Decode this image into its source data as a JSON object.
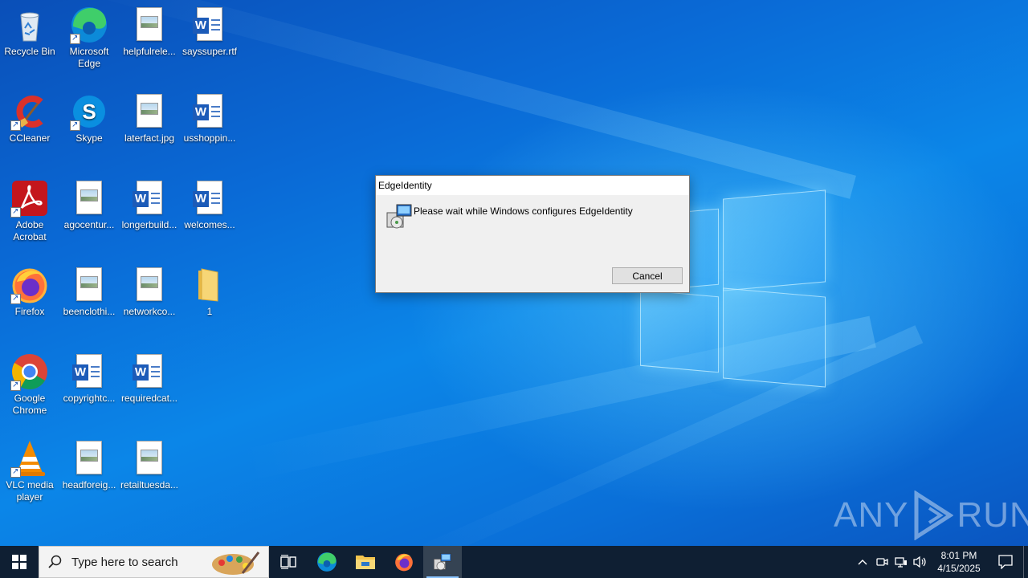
{
  "desktop": {
    "icons": [
      {
        "label": "Recycle Bin",
        "icon": "recycle-bin-icon"
      },
      {
        "label": "Microsoft Edge",
        "icon": "edge-icon"
      },
      {
        "label": "helpfulrele...",
        "icon": "image-file-icon"
      },
      {
        "label": "sayssuper.rtf",
        "icon": "word-doc-icon"
      },
      {
        "label": "CCleaner",
        "icon": "ccleaner-icon"
      },
      {
        "label": "Skype",
        "icon": "skype-icon"
      },
      {
        "label": "laterfact.jpg",
        "icon": "image-file-icon"
      },
      {
        "label": "usshoppin...",
        "icon": "word-doc-icon"
      },
      {
        "label": "Adobe Acrobat",
        "icon": "acrobat-icon"
      },
      {
        "label": "agocentur...",
        "icon": "image-file-icon"
      },
      {
        "label": "longerbuild...",
        "icon": "word-doc-icon"
      },
      {
        "label": "welcomes...",
        "icon": "word-doc-icon"
      },
      {
        "label": "Firefox",
        "icon": "firefox-icon"
      },
      {
        "label": "beenclothi...",
        "icon": "image-file-icon"
      },
      {
        "label": "networkco...",
        "icon": "image-file-icon"
      },
      {
        "label": "1",
        "icon": "folder-icon"
      },
      {
        "label": "Google Chrome",
        "icon": "chrome-icon"
      },
      {
        "label": "copyrightc...",
        "icon": "word-doc-icon"
      },
      {
        "label": "requiredcat...",
        "icon": "word-doc-icon"
      },
      {
        "label": "VLC media player",
        "icon": "vlc-icon"
      },
      {
        "label": "headforeig...",
        "icon": "image-file-icon"
      },
      {
        "label": "retailtuesda...",
        "icon": "image-file-icon"
      }
    ],
    "watermark": {
      "left": "ANY",
      "right": "RUN"
    }
  },
  "dialog": {
    "title": "EdgeIdentity",
    "message": "Please wait while Windows configures EdgeIdentity",
    "cancel_label": "Cancel",
    "icon": "installer-icon"
  },
  "taskbar": {
    "search_placeholder": "Type here to search",
    "apps": [
      "task-view-icon",
      "edge-icon",
      "file-explorer-icon",
      "firefox-icon",
      "installer-icon"
    ],
    "active_app": "installer-icon",
    "clock": {
      "time": "8:01 PM",
      "date": "4/15/2025"
    },
    "tray_icons": [
      "chevron-up-icon",
      "meet-now-icon",
      "network-icon",
      "volume-icon"
    ],
    "notification_icon": "action-center-icon"
  },
  "colors": {
    "taskbar": "#0f1f33",
    "desktop_blue": "#0b86e8",
    "dialog_bg": "#f0f0f0"
  }
}
